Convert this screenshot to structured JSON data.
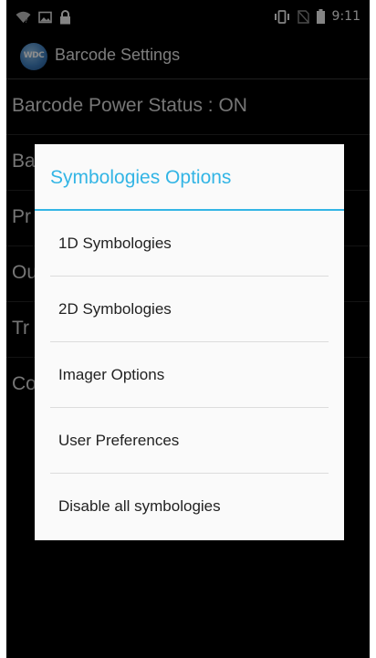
{
  "status_bar": {
    "time": "9:11",
    "icons_left": [
      "wifi-icon",
      "image-icon",
      "lock-icon"
    ],
    "icons_right": [
      "vibrate-icon",
      "no-sim-icon",
      "battery-icon"
    ]
  },
  "action_bar": {
    "logo_text": "WDC",
    "title": "Barcode Settings"
  },
  "settings": {
    "items": [
      {
        "label": "Barcode Power Status : ON"
      },
      {
        "label": "Ba"
      },
      {
        "label": "Pr"
      },
      {
        "label": "Ou"
      },
      {
        "label": "Tr"
      },
      {
        "label": "Co"
      }
    ]
  },
  "dialog": {
    "title": "Symbologies Options",
    "accent_color": "#33b5e5",
    "options": [
      {
        "label": "1D Symbologies"
      },
      {
        "label": "2D Symbologies"
      },
      {
        "label": "Imager Options"
      },
      {
        "label": "User Preferences"
      },
      {
        "label": "Disable all symbologies"
      }
    ]
  }
}
